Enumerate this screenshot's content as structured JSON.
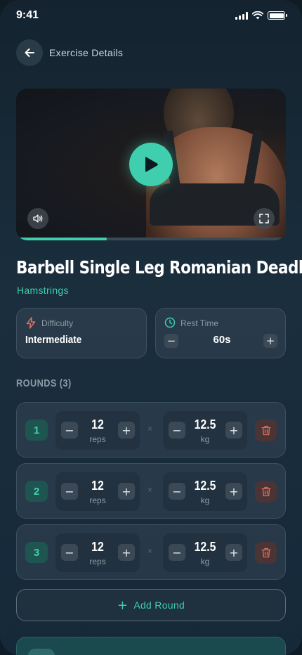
{
  "status_bar": {
    "time": "9:41"
  },
  "header": {
    "title": "Exercise Details"
  },
  "video": {
    "progress": 0.33
  },
  "exercise": {
    "title": "Barbell Single Leg Romanian Deadlifts",
    "muscle": "Hamstrings"
  },
  "difficulty": {
    "label": "Difficulty",
    "value": "Intermediate"
  },
  "rest": {
    "label": "Rest Time",
    "value": "60s",
    "minus": "−",
    "plus": "+"
  },
  "rounds": {
    "heading": "ROUNDS (3)",
    "items": [
      {
        "number": "1",
        "reps": "12",
        "reps_unit": "reps",
        "weight": "12.5",
        "weight_unit": "kg"
      },
      {
        "number": "2",
        "reps": "12",
        "reps_unit": "reps",
        "weight": "12.5",
        "weight_unit": "kg"
      },
      {
        "number": "3",
        "reps": "12",
        "reps_unit": "reps",
        "weight": "12.5",
        "weight_unit": "kg"
      }
    ],
    "times_symbol": "×",
    "minus": "−",
    "plus": "+"
  },
  "add_round": {
    "label": "Add Round",
    "icon": "+"
  },
  "colors": {
    "accent": "#3fcfae",
    "danger": "#e0705a",
    "background": "#14232f"
  }
}
